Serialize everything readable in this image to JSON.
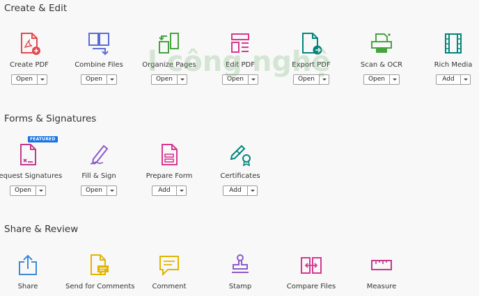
{
  "sections": {
    "create_edit": "Create & Edit",
    "forms_signatures": "Forms & Signatures",
    "share_review": "Share & Review"
  },
  "create_edit_tools": [
    {
      "label": "Create PDF",
      "button": "Open",
      "icon": "create-pdf-icon"
    },
    {
      "label": "Combine Files",
      "button": "Open",
      "icon": "combine-files-icon"
    },
    {
      "label": "Organize Pages",
      "button": "Open",
      "icon": "organize-pages-icon"
    },
    {
      "label": "Edit PDF",
      "button": "Open",
      "icon": "edit-pdf-icon"
    },
    {
      "label": "Export PDF",
      "button": "Open",
      "icon": "export-pdf-icon"
    },
    {
      "label": "Scan & OCR",
      "button": "Open",
      "icon": "scan-ocr-icon"
    },
    {
      "label": "Rich Media",
      "button": "Add",
      "icon": "rich-media-icon"
    }
  ],
  "forms_tools": [
    {
      "label": "Request Signatures",
      "button": "Open",
      "icon": "request-signatures-icon"
    },
    {
      "label": "Fill & Sign",
      "button": "Open",
      "icon": "fill-sign-icon"
    },
    {
      "label": "Prepare Form",
      "button": "Add",
      "icon": "prepare-form-icon"
    },
    {
      "label": "Certificates",
      "button": "Add",
      "icon": "certificates-icon"
    }
  ],
  "share_tools": [
    {
      "label": "Share",
      "icon": "share-icon"
    },
    {
      "label": "Send for Comments",
      "icon": "send-for-comments-icon"
    },
    {
      "label": "Comment",
      "icon": "comment-icon"
    },
    {
      "label": "Stamp",
      "icon": "stamp-icon"
    },
    {
      "label": "Compare Files",
      "icon": "compare-files-icon"
    },
    {
      "label": "Measure",
      "icon": "measure-icon"
    }
  ],
  "featured_badge": "FEATURED",
  "watermark": "l công nghệ",
  "colors": {
    "red": "#e34850",
    "blue": "#5a6bd6",
    "green": "#45a340",
    "pink": "#d83790",
    "teal": "#00857a",
    "lightblue": "#3d8bd4",
    "yellow": "#e1b400",
    "purple": "#8c5ac8",
    "magenta": "#c0398d"
  }
}
